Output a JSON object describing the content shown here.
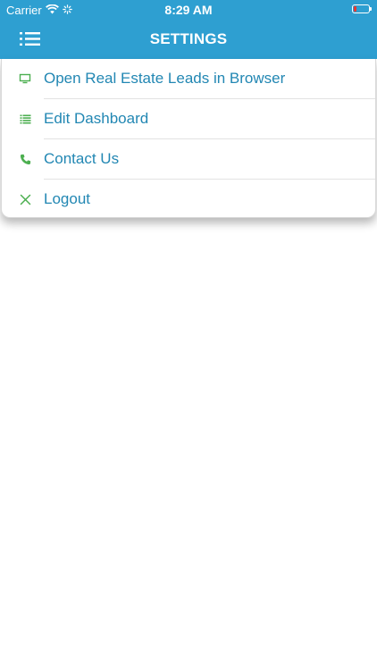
{
  "status_bar": {
    "carrier": "Carrier",
    "time": "8:29 AM",
    "battery_color": "#e8382f"
  },
  "header": {
    "title": "SETTINGS",
    "background": "#2e9fd1",
    "menu_icon": "hamburger-list-icon"
  },
  "menu": {
    "label_color": "#2287b3",
    "icon_color": "#4caf50",
    "items": [
      {
        "label": "Open Real Estate Leads in Browser",
        "icon": "monitor-icon"
      },
      {
        "label": "Edit Dashboard",
        "icon": "list-icon"
      },
      {
        "label": "Contact Us",
        "icon": "phone-icon"
      },
      {
        "label": "Logout",
        "icon": "close-icon"
      }
    ]
  }
}
